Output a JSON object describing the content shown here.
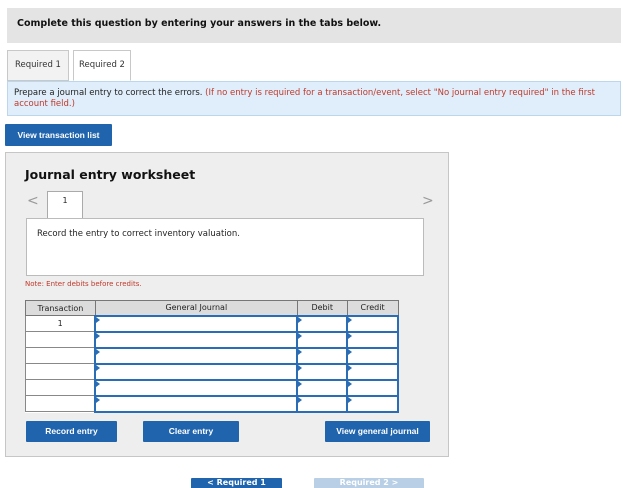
{
  "header": {
    "title": "Complete this question by entering your answers in the tabs below."
  },
  "tabs": [
    {
      "label": "Required 1",
      "active": false
    },
    {
      "label": "Required 2",
      "active": true
    }
  ],
  "instruction": {
    "text": "Prepare a journal entry to correct the errors.",
    "hint": "(If no entry is required for a transaction/event, select \"No journal entry required\" in the first account field.)"
  },
  "buttons": {
    "view_transaction_list": "View transaction list",
    "record_entry": "Record entry",
    "clear_entry": "Clear entry",
    "view_general_journal": "View general journal"
  },
  "worksheet": {
    "title": "Journal entry worksheet",
    "nav_prev": "<",
    "nav_next": ">",
    "page": "1",
    "description": "Record the entry to correct inventory valuation.",
    "note": "Note: Enter debits before credits."
  },
  "journal": {
    "columns": [
      "Transaction",
      "General Journal",
      "Debit",
      "Credit"
    ],
    "rows": [
      {
        "transaction": "1"
      },
      {
        "transaction": ""
      },
      {
        "transaction": ""
      },
      {
        "transaction": ""
      },
      {
        "transaction": ""
      },
      {
        "transaction": ""
      }
    ]
  },
  "bottom_nav": {
    "prev": "< Required 1",
    "next": "Required 2 >"
  },
  "colors": {
    "primary_button": "#1f64ad",
    "instruction_bg": "#dfeefa",
    "note_red": "#c0392b"
  }
}
